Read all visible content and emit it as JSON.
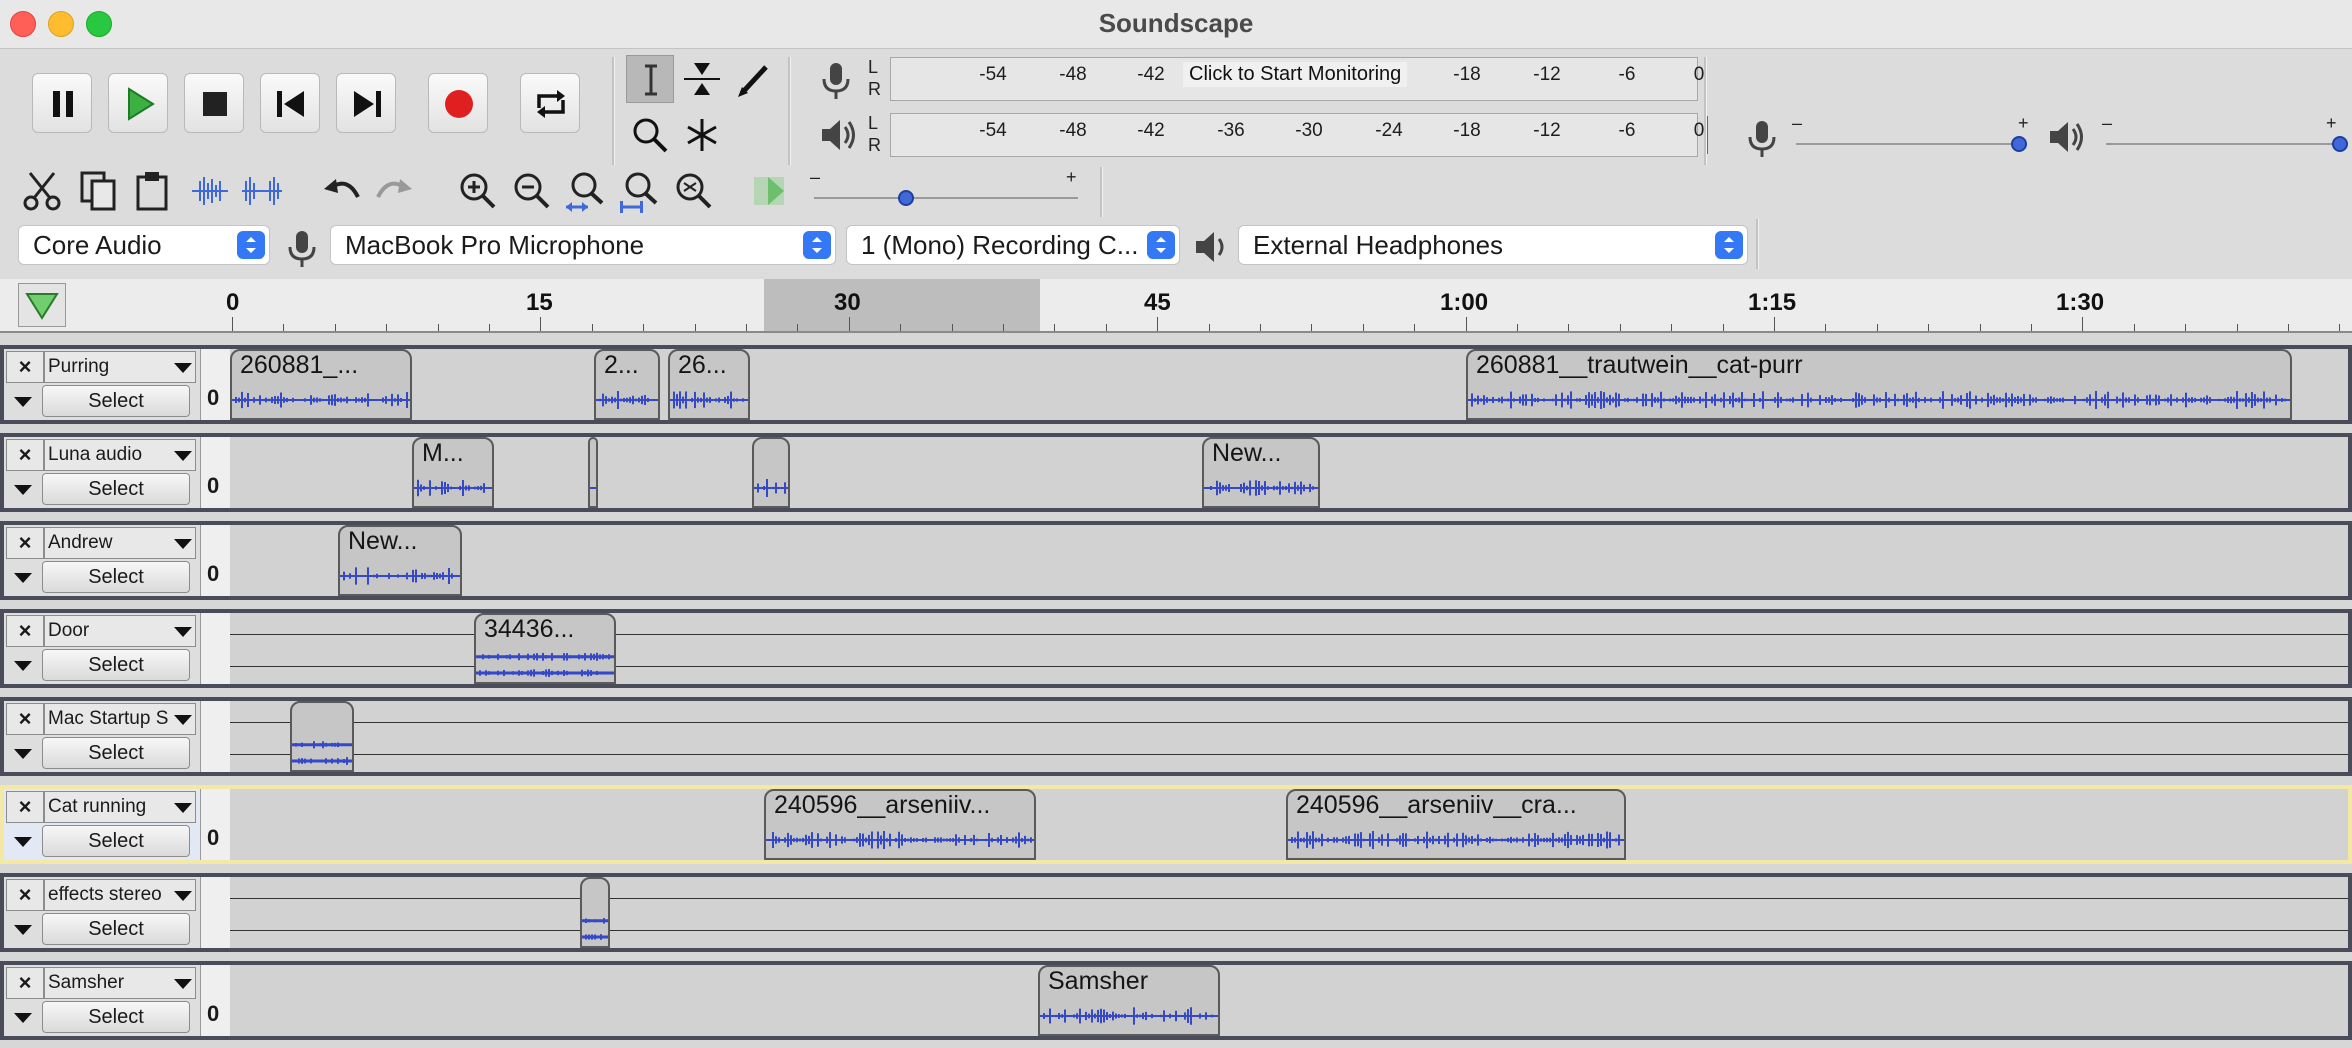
{
  "window": {
    "title": "Soundscape"
  },
  "meters": {
    "record_ticks": [
      "-54",
      "-48",
      "-42",
      "-18",
      "-12",
      "-6",
      "0"
    ],
    "record_monitor_label": "Click to Start Monitoring",
    "playback_ticks": [
      "-54",
      "-48",
      "-42",
      "-36",
      "-30",
      "-24",
      "-18",
      "-12",
      "-6",
      "0"
    ],
    "channel_left": "L",
    "channel_right": "R"
  },
  "sliders": {
    "minus": "–",
    "plus": "+",
    "record_volume": 0.97,
    "playback_volume": 1.0,
    "play_speed": 0.35
  },
  "device_toolbar": {
    "host": "Core Audio",
    "input_device": "MacBook Pro Microphone",
    "channels": "1 (Mono) Recording C...",
    "output_device": "External Headphones"
  },
  "timeline": {
    "labels": [
      "0",
      "15",
      "30",
      "45",
      "1:00",
      "1:15",
      "1:30"
    ]
  },
  "track_common": {
    "close": "×",
    "select_label": "Select",
    "zero": "0"
  },
  "tracks": [
    {
      "name": "Purring",
      "clips": [
        {
          "label": "260881_..."
        },
        {
          "label": "2..."
        },
        {
          "label": "26..."
        },
        {
          "label": "260881__trautwein__cat-purr"
        }
      ]
    },
    {
      "name": "Luna audio",
      "clips": [
        {
          "label": "M..."
        },
        {
          "label": ""
        },
        {
          "label": ""
        },
        {
          "label": "New..."
        }
      ]
    },
    {
      "name": "Andrew",
      "clips": [
        {
          "label": "New..."
        }
      ]
    },
    {
      "name": "Door",
      "clips": [
        {
          "label": "34436..."
        }
      ]
    },
    {
      "name": "Mac Startup S",
      "clips": [
        {
          "label": ""
        }
      ]
    },
    {
      "name": "Cat running",
      "clips": [
        {
          "label": "240596__arseniiv..."
        },
        {
          "label": "240596__arseniiv__cra..."
        }
      ]
    },
    {
      "name": "effects stereo",
      "clips": [
        {
          "label": ""
        }
      ]
    },
    {
      "name": "Samsher",
      "clips": [
        {
          "label": "Samsher"
        }
      ]
    }
  ]
}
